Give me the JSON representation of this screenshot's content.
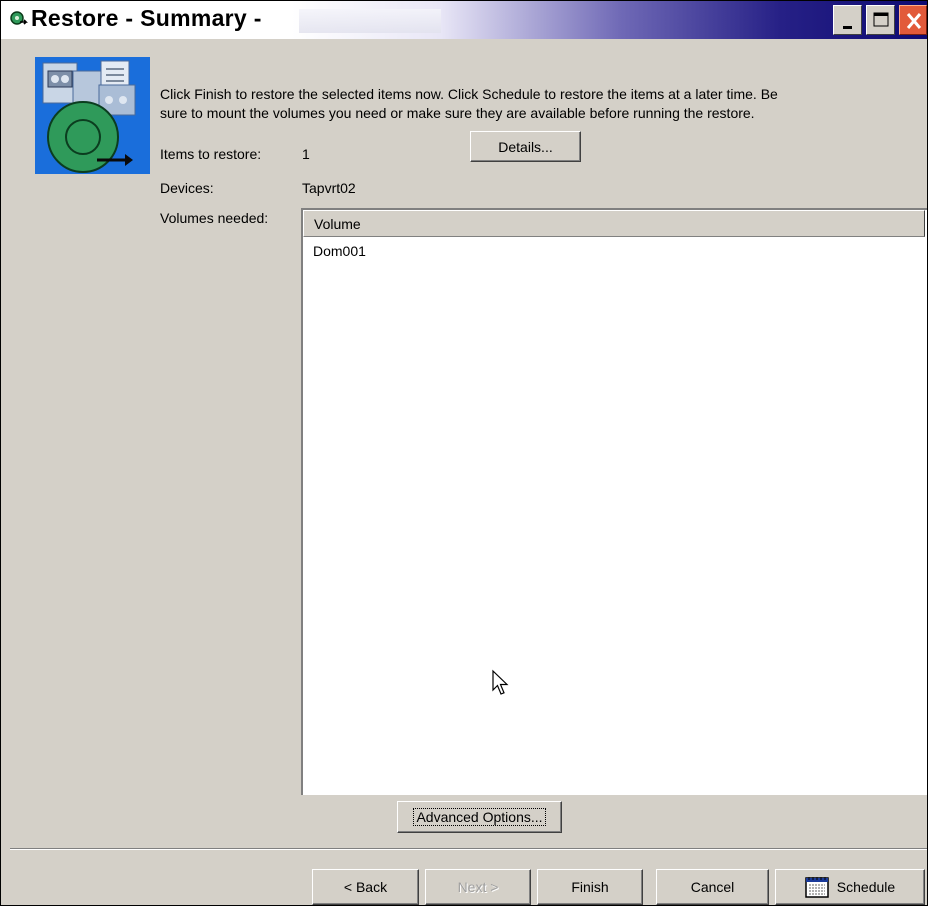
{
  "window": {
    "title": "Restore - Summary -"
  },
  "intro": {
    "line1": "Click Finish to restore the selected items now.  Click Schedule to restore the items at a later time. Be",
    "line2": "sure to mount the volumes you need or make sure they are available before running the restore."
  },
  "summary": {
    "items_label": "Items to restore:",
    "items_value": "1",
    "details_button": "Details...",
    "devices_label": "Devices:",
    "devices_value": "Tapvrt02",
    "volumes_label": "Volumes needed:"
  },
  "volumes_table": {
    "columns": [
      "Volume"
    ],
    "rows": [
      [
        "Dom001"
      ]
    ]
  },
  "buttons": {
    "advanced": "Advanced Options...",
    "back": "< Back",
    "next": "Next >",
    "finish": "Finish",
    "cancel": "Cancel",
    "schedule": "Schedule"
  },
  "icons": {
    "title": "restore-app-icon",
    "banner": "tape-restore-icon",
    "schedule": "calendar-icon",
    "cursor": "mouse-pointer-icon"
  },
  "colors": {
    "title_gradient_end": "#0e0a72",
    "banner_bg": "#1a6edb",
    "disc_green": "#2f9a5a",
    "dialog_bg": "#d4d0c8"
  }
}
